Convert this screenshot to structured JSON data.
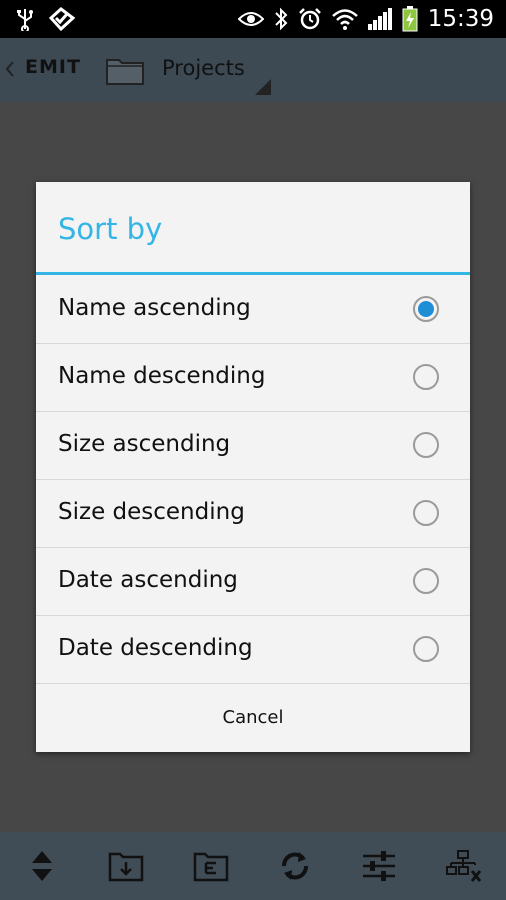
{
  "status_bar": {
    "time": "15:39",
    "icons": [
      "usb-icon",
      "check-app-icon",
      "eye-icon",
      "bluetooth-icon",
      "alarm-icon",
      "wifi-icon",
      "signal-icon",
      "battery-charging-icon"
    ]
  },
  "app_bar": {
    "logo": "EMIT",
    "title": "Projects"
  },
  "dialog": {
    "title": "Sort by",
    "accent_color": "#33b5e5",
    "options": [
      {
        "label": "Name ascending",
        "selected": true
      },
      {
        "label": "Name descending",
        "selected": false
      },
      {
        "label": "Size ascending",
        "selected": false
      },
      {
        "label": "Size descending",
        "selected": false
      },
      {
        "label": "Date ascending",
        "selected": false
      },
      {
        "label": "Date descending",
        "selected": false
      }
    ],
    "cancel_label": "Cancel"
  },
  "bottom_bar": {
    "buttons": [
      "sort-icon",
      "import-folder-icon",
      "folder-details-icon",
      "refresh-icon",
      "settings-sliders-icon",
      "network-disconnect-icon"
    ]
  }
}
